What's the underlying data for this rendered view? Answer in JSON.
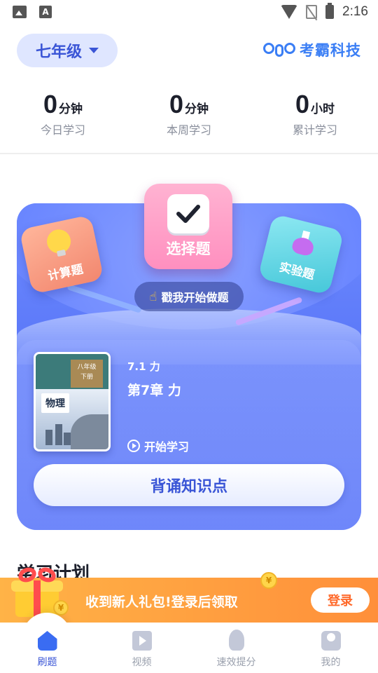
{
  "status_bar": {
    "time": "2:16",
    "notif_badge": "A"
  },
  "header": {
    "grade_label": "七年级",
    "brand_name": "考霸科技"
  },
  "stats": [
    {
      "value": "0",
      "unit": "分钟",
      "label": "今日学习"
    },
    {
      "value": "0",
      "unit": "分钟",
      "label": "本周学习"
    },
    {
      "value": "0",
      "unit": "小时",
      "label": "累计学习"
    }
  ],
  "practice": {
    "calc_label": "计算题",
    "choice_label": "选择题",
    "experiment_label": "实验题",
    "start_prompt": "戳我开始做题"
  },
  "lesson": {
    "book_word": "物理",
    "book_grade": "八年级",
    "book_volume": "下册",
    "section": "7.1 力",
    "chapter": "第7章 力",
    "start_label": "开始学习",
    "memorize_button": "背诵知识点"
  },
  "next_section_heading": "学习计划",
  "banner": {
    "text": "收到新人礼包!登录后领取",
    "login_label": "登录",
    "coin_symbol": "¥"
  },
  "bottom_nav": [
    {
      "label": "刷题",
      "icon": "home-icon",
      "active": true
    },
    {
      "label": "视频",
      "icon": "video-icon",
      "active": false
    },
    {
      "label": "速效提分",
      "icon": "rocket-icon",
      "active": false
    },
    {
      "label": "我的",
      "icon": "user-icon",
      "active": false
    }
  ],
  "colors": {
    "accent": "#3a55d6",
    "brand": "#3a7ef5",
    "banner": "#ff8f3a"
  }
}
